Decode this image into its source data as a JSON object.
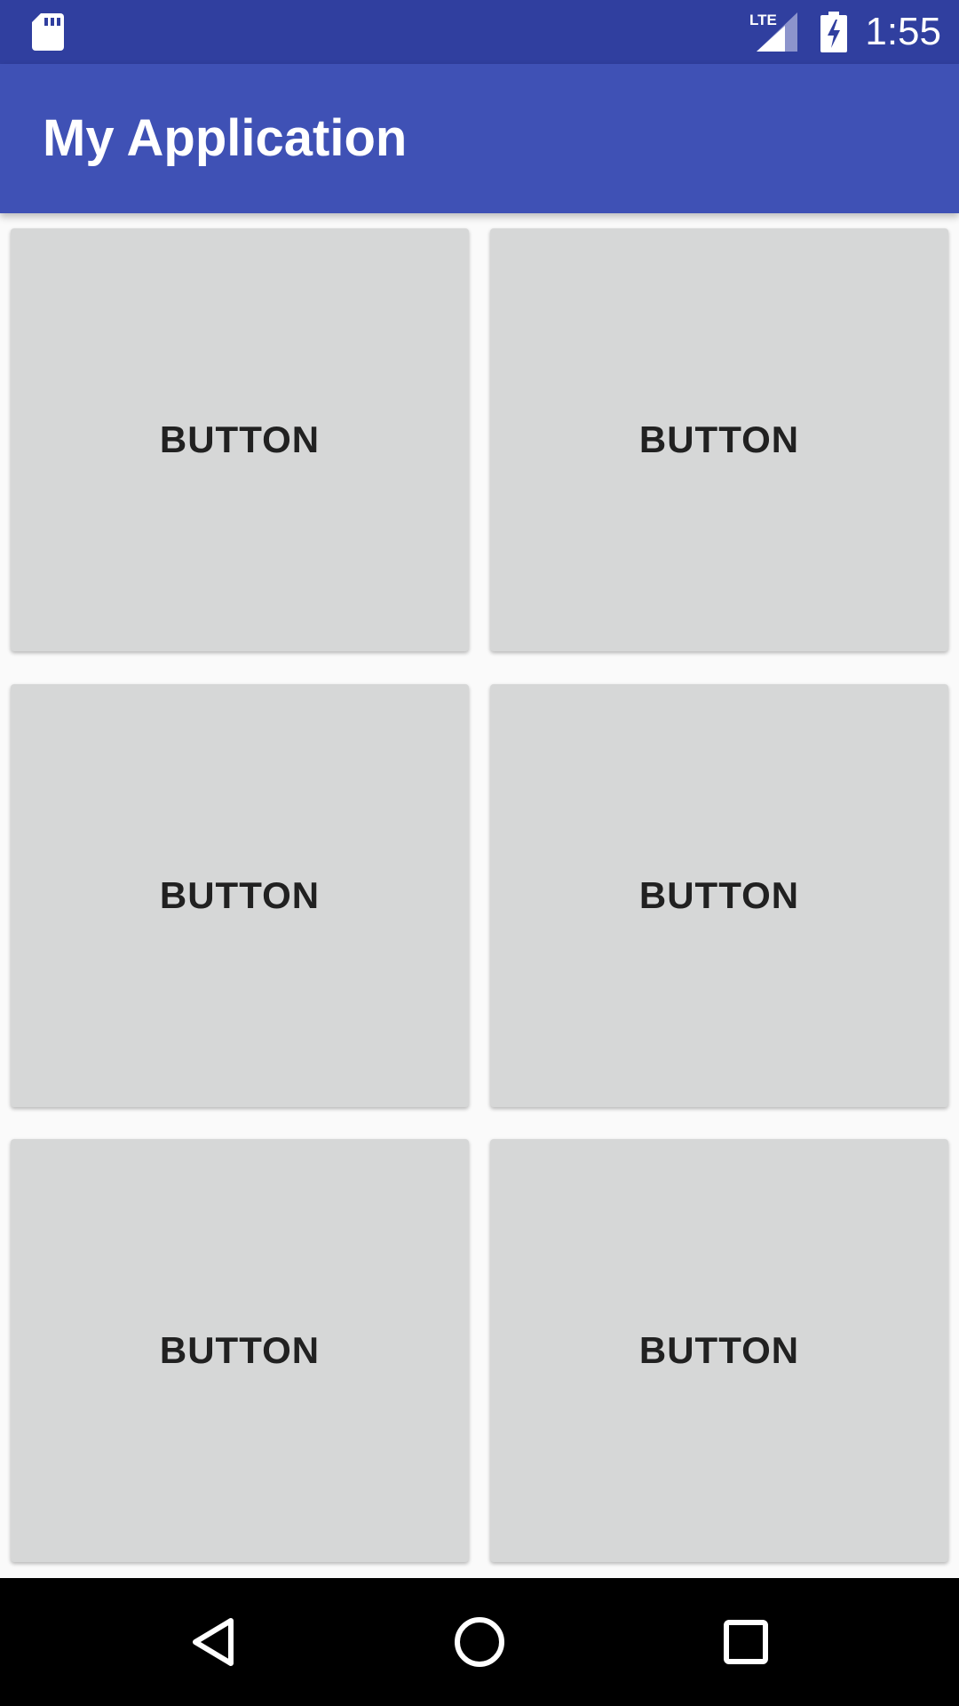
{
  "status_bar": {
    "time": "1:55",
    "network_label": "LTE",
    "icons": [
      "sd-card-icon",
      "lte-signal-icon",
      "battery-charging-icon"
    ]
  },
  "app_bar": {
    "title": "My Application"
  },
  "buttons": [
    {
      "label": "BUTTON"
    },
    {
      "label": "BUTTON"
    },
    {
      "label": "BUTTON"
    },
    {
      "label": "BUTTON"
    },
    {
      "label": "BUTTON"
    },
    {
      "label": "BUTTON"
    }
  ],
  "nav_bar": {
    "icons": [
      "back-icon",
      "home-icon",
      "recents-icon"
    ]
  },
  "colors": {
    "status_bar": "#303f9f",
    "app_bar": "#3f51b5",
    "background": "#fafafa",
    "button": "#d6d7d7",
    "button_text": "#212121",
    "nav_bar": "#000000"
  }
}
